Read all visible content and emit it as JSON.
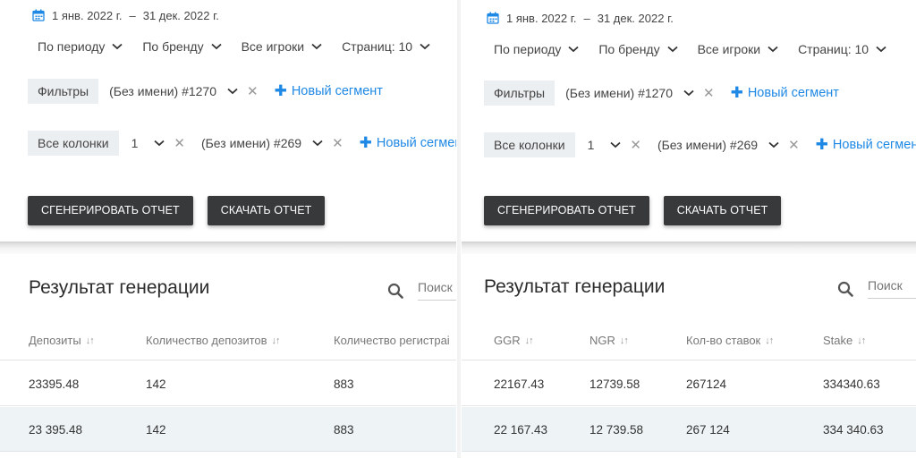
{
  "left": {
    "date": {
      "from": "1 янв. 2022 г.",
      "sep": "–",
      "to": "31 дек. 2022 г."
    },
    "filters": {
      "period": "По периоду",
      "brand": "По бренду",
      "players": "Все игроки",
      "pages": "Страниц: 10"
    },
    "segments": {
      "filters_tag": "Фильтры",
      "filter_name": "(Без имени) #1270",
      "new_segment": "Новый сегмент",
      "columns_tag": "Все колонки",
      "columns_count": "1",
      "columns_name": "(Без имени) #269",
      "new_segment2": "Новый сегмен"
    },
    "buttons": {
      "generate": "СГЕНЕРИРОВАТЬ ОТЧЕТ",
      "download": "СКАЧАТЬ ОТЧЕТ"
    },
    "result": {
      "title": "Результат генерации",
      "search_placeholder": "Поиск"
    },
    "table": {
      "headers": [
        "Депозиты",
        "Количество депозитов",
        "Количество регистраі"
      ],
      "rows": [
        [
          "23395.48",
          "142",
          "883"
        ],
        [
          "23 395.48",
          "142",
          "883"
        ]
      ]
    }
  },
  "right": {
    "date": {
      "from": "1 янв. 2022 г.",
      "sep": "–",
      "to": "31 дек. 2022 г."
    },
    "filters": {
      "period": "По периоду",
      "brand": "По бренду",
      "players": "Все игроки",
      "pages": "Страниц: 10"
    },
    "segments": {
      "filters_tag": "Фильтры",
      "filter_name": "(Без имени) #1270",
      "new_segment": "Новый сегмент",
      "columns_tag": "Все колонки",
      "columns_count": "1",
      "columns_name": "(Без имени) #269",
      "new_segment2": "Новый сегмент"
    },
    "buttons": {
      "generate": "СГЕНЕРИРОВАТЬ ОТЧЕТ",
      "download": "СКАЧАТЬ ОТЧЕТ"
    },
    "result": {
      "title": "Результат генерации",
      "search_placeholder": "Поиск"
    },
    "table": {
      "headers": [
        "GGR",
        "NGR",
        "Кол-во ставок",
        "Stake"
      ],
      "rows": [
        [
          "22167.43",
          "12739.58",
          "267124",
          "334340.63"
        ],
        [
          "22 167.43",
          "12 739.58",
          "267 124",
          "334 340.63"
        ]
      ]
    }
  },
  "icons": {
    "calendar": "calendar-icon",
    "chevron": "chevron-down-icon",
    "close": "close-icon",
    "plus": "plus-icon",
    "search": "search-icon",
    "sort": "sort-icon"
  },
  "colors": {
    "accent": "#1e88e5",
    "button_bg": "#37393a",
    "tag_bg": "#eceff1",
    "row_highlight": "#eef3f6",
    "calendar": "#1e88e5"
  }
}
